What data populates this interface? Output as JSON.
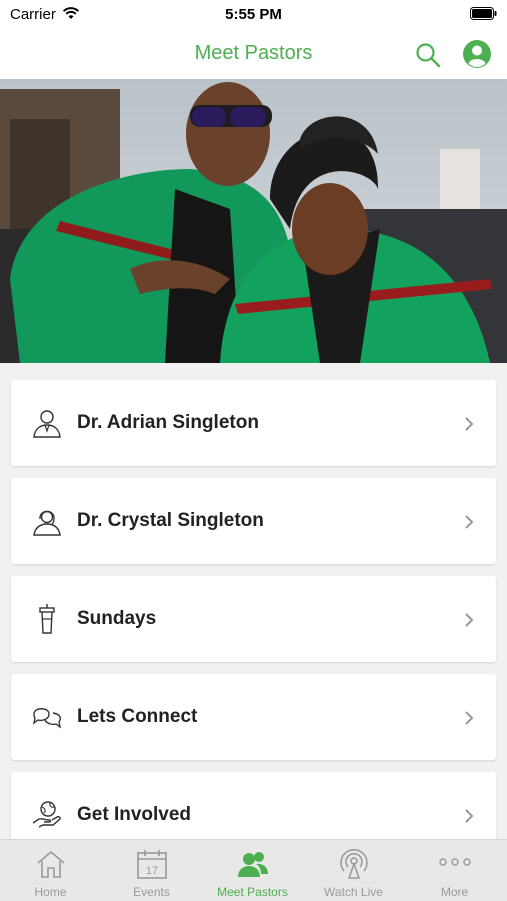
{
  "status": {
    "carrier": "Carrier",
    "time": "5:55 PM"
  },
  "nav": {
    "title": "Meet Pastors"
  },
  "colors": {
    "accent": "#4caf50",
    "card_bg": "#ffffff",
    "bg": "#f1f1f1"
  },
  "items": [
    {
      "label": "Dr. Adrian Singleton",
      "icon": "man-person-icon"
    },
    {
      "label": "Dr. Crystal Singleton",
      "icon": "woman-person-icon"
    },
    {
      "label": "Sundays",
      "icon": "pulpit-icon"
    },
    {
      "label": "Lets Connect",
      "icon": "chat-bubbles-icon"
    },
    {
      "label": "Get Involved",
      "icon": "hand-globe-icon"
    }
  ],
  "tabs": [
    {
      "label": "Home",
      "icon": "home-icon"
    },
    {
      "label": "Events",
      "icon": "calendar-icon",
      "day": "17"
    },
    {
      "label": "Meet Pastors",
      "icon": "people-icon",
      "active": true
    },
    {
      "label": "Watch Live",
      "icon": "broadcast-icon"
    },
    {
      "label": "More",
      "icon": "more-dots-icon"
    }
  ]
}
